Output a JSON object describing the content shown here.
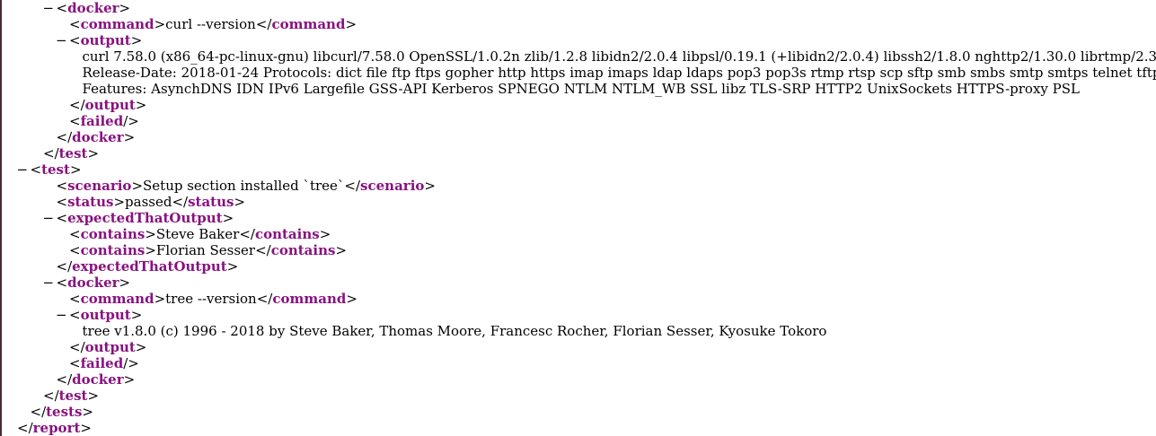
{
  "colors": {
    "tag": "#881280",
    "text": "#000000",
    "background": "#ffffff"
  },
  "toggle_glyph": "−",
  "lines": [
    {
      "indent": 3,
      "toggle": true,
      "open": "docker"
    },
    {
      "indent": 4,
      "open": "command",
      "text": "curl --version",
      "close": "command"
    },
    {
      "indent": 4,
      "toggle": true,
      "open": "output"
    },
    {
      "indent": 5,
      "text": "curl 7.58.0 (x86_64-pc-linux-gnu) libcurl/7.58.0 OpenSSL/1.0.2n zlib/1.2.8 libidn2/2.0.4 libpsl/0.19.1 (+libidn2/2.0.4) libssh2/1.8.0 nghttp2/1.30.0 librtmp/2.3"
    },
    {
      "indent": 5,
      "text": "Release-Date: 2018-01-24 Protocols: dict file ftp ftps gopher http https imap imaps ldap ldaps pop3 pop3s rtmp rtsp scp sftp smb smbs smtp smtps telnet tftp"
    },
    {
      "indent": 5,
      "text": "Features: AsynchDNS IDN IPv6 Largefile GSS-API Kerberos SPNEGO NTLM NTLM_WB SSL libz TLS-SRP HTTP2 UnixSockets HTTPS-proxy PSL"
    },
    {
      "indent": 4,
      "close": "output"
    },
    {
      "indent": 4,
      "selfclose": "failed"
    },
    {
      "indent": 3,
      "close": "docker"
    },
    {
      "indent": 2,
      "close": "test"
    },
    {
      "indent": 1,
      "toggle": true,
      "open": "test"
    },
    {
      "indent": 3,
      "open": "scenario",
      "text": "Setup section installed `tree`",
      "close": "scenario"
    },
    {
      "indent": 3,
      "open": "status",
      "text": "passed",
      "close": "status"
    },
    {
      "indent": 3,
      "toggle": true,
      "open": "expectedThatOutput"
    },
    {
      "indent": 4,
      "open": "contains",
      "text": "Steve Baker",
      "close": "contains"
    },
    {
      "indent": 4,
      "open": "contains",
      "text": "Florian Sesser",
      "close": "contains"
    },
    {
      "indent": 3,
      "close": "expectedThatOutput"
    },
    {
      "indent": 3,
      "toggle": true,
      "open": "docker"
    },
    {
      "indent": 4,
      "open": "command",
      "text": "tree --version",
      "close": "command"
    },
    {
      "indent": 4,
      "toggle": true,
      "open": "output"
    },
    {
      "indent": 5,
      "text": "tree v1.8.0 (c) 1996 - 2018 by Steve Baker, Thomas Moore, Francesc Rocher, Florian Sesser, Kyosuke Tokoro"
    },
    {
      "indent": 4,
      "close": "output"
    },
    {
      "indent": 4,
      "selfclose": "failed"
    },
    {
      "indent": 3,
      "close": "docker"
    },
    {
      "indent": 2,
      "close": "test"
    },
    {
      "indent": 1,
      "close": "tests"
    },
    {
      "indent": 0,
      "close": "report"
    }
  ]
}
